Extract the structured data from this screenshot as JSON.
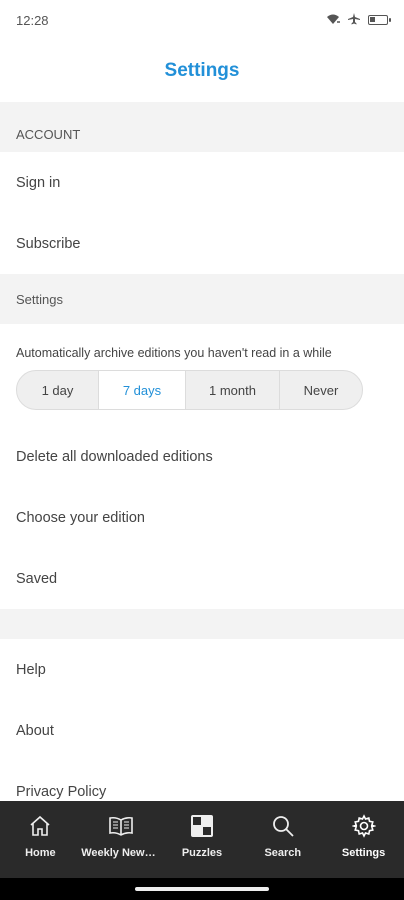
{
  "status_bar": {
    "time": "12:28",
    "icons": [
      "wifi-icon",
      "airplane-icon",
      "battery-icon"
    ],
    "battery_level": 0.3
  },
  "header": {
    "title": "Settings"
  },
  "account_section": {
    "title": "ACCOUNT",
    "items": [
      {
        "label": "Sign in"
      },
      {
        "label": "Subscribe"
      }
    ]
  },
  "settings_section": {
    "title": "Settings",
    "archive": {
      "description": "Automatically archive editions you haven't read in a while",
      "options": [
        "1 day",
        "7 days",
        "1 month",
        "Never"
      ],
      "selected": "7 days"
    },
    "items": [
      {
        "label": "Delete all downloaded editions"
      },
      {
        "label": "Choose your edition"
      },
      {
        "label": "Saved"
      }
    ]
  },
  "info_section": {
    "items": [
      {
        "label": "Help"
      },
      {
        "label": "About"
      },
      {
        "label": "Privacy Policy"
      }
    ]
  },
  "bottom_nav": {
    "items": [
      {
        "label": "Home",
        "icon": "home-icon"
      },
      {
        "label": "Weekly News…",
        "icon": "book-icon"
      },
      {
        "label": "Puzzles",
        "icon": "puzzle-icon"
      },
      {
        "label": "Search",
        "icon": "search-icon"
      },
      {
        "label": "Settings",
        "icon": "gear-icon",
        "active": true
      }
    ]
  },
  "colors": {
    "accent": "#2290d8",
    "section_bg": "#f3f3f3",
    "nav_bg": "#2a2a2a"
  }
}
